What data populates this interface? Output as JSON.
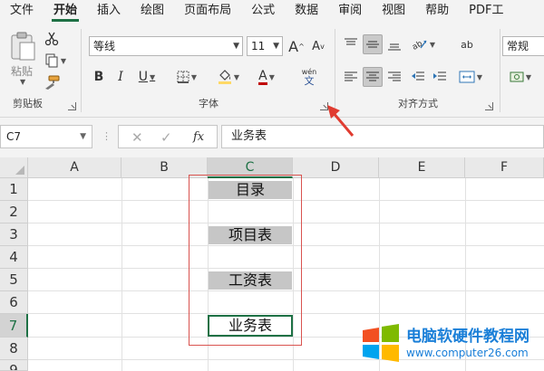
{
  "menu": {
    "items": [
      "文件",
      "开始",
      "插入",
      "绘图",
      "页面布局",
      "公式",
      "数据",
      "审阅",
      "视图",
      "帮助",
      "PDF工"
    ],
    "active_index": 1
  },
  "ribbon": {
    "clipboard": {
      "label": "剪贴板",
      "paste_label": "粘贴",
      "icons": [
        "clipboard-icon",
        "cut-icon",
        "copy-icon",
        "format-painter-icon"
      ]
    },
    "font": {
      "label": "字体",
      "font_name": "等线",
      "font_size": "11",
      "grow_glyph": "A",
      "shrink_glyph": "A",
      "bold_glyph": "B",
      "italic_glyph": "I",
      "underline_glyph": "U",
      "font_color_glyph": "A",
      "phonetic_glyph": "wén",
      "phonetic_sub_glyph": "文"
    },
    "alignment": {
      "label": "对齐方式",
      "pressed": [
        "align-middle",
        "align-center"
      ]
    },
    "number": {
      "format": "常规",
      "wrap_glyph": "ab"
    }
  },
  "formula_bar": {
    "name_box": "C7",
    "fx_label": "fx",
    "content": "业务表"
  },
  "grid": {
    "columns": [
      "A",
      "B",
      "C",
      "D",
      "E",
      "F"
    ],
    "selected_column": "C",
    "rows": [
      "1",
      "2",
      "3",
      "4",
      "5",
      "6",
      "7",
      "8",
      "9"
    ],
    "selected_row": "7",
    "cells": {
      "C1": "目录",
      "C3": "项目表",
      "C5": "工资表",
      "C7": "业务表"
    },
    "gray_fill": "#c6c6c6",
    "accent": "#1e7145",
    "highlight_box_color": "#d9534f"
  },
  "watermark": {
    "title": "电脑软硬件教程网",
    "url": "www.computer26.com",
    "color": "#1a7fd8"
  }
}
